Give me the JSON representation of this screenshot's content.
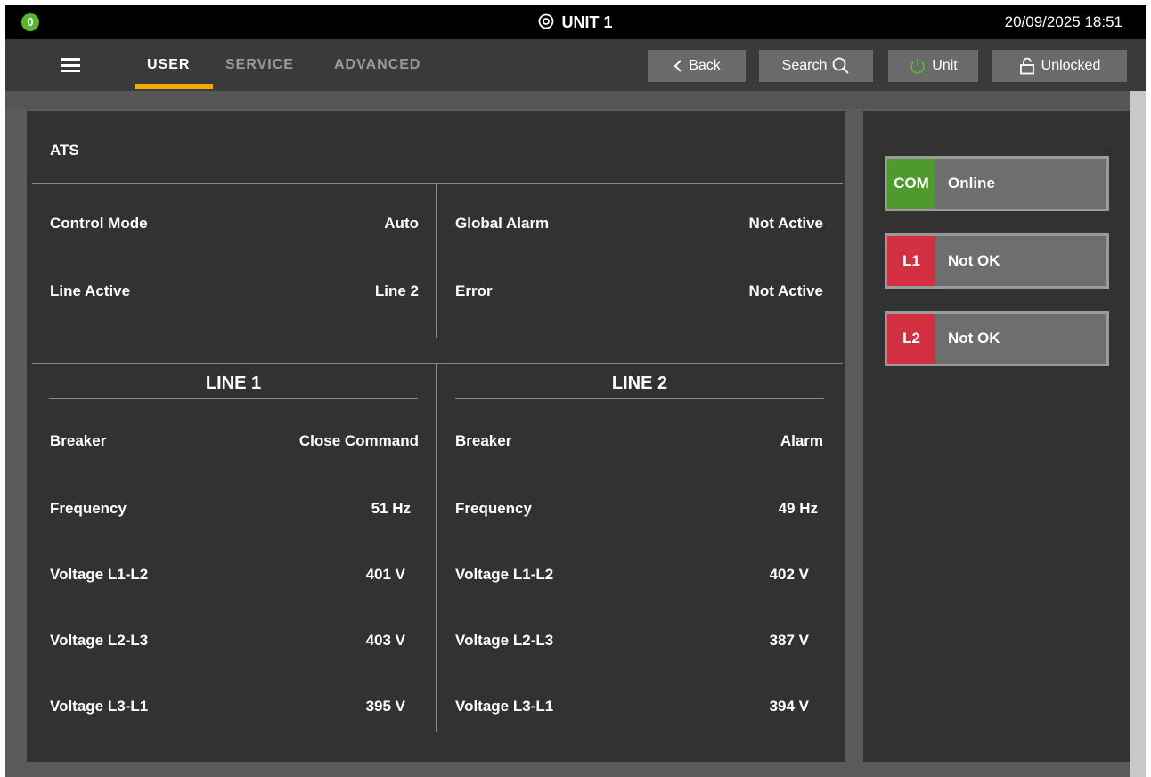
{
  "topbar": {
    "badge_count": "0",
    "unit_title": "UNIT 1",
    "datetime": "20/09/2025 18:51"
  },
  "nav": {
    "tabs": [
      {
        "label": "USER",
        "active": true
      },
      {
        "label": "SERVICE",
        "active": false
      },
      {
        "label": "ADVANCED",
        "active": false
      }
    ],
    "back_label": "Back",
    "search_label": "Search",
    "unit_label": "Unit",
    "lock_label": "Unlocked"
  },
  "ats": {
    "title": "ATS",
    "control_mode_label": "Control Mode",
    "control_mode_value": "Auto",
    "line_active_label": "Line Active",
    "line_active_value": "Line 2",
    "global_alarm_label": "Global Alarm",
    "global_alarm_value": "Not Active",
    "error_label": "Error",
    "error_value": "Not Active"
  },
  "line1": {
    "title": "LINE 1",
    "rows": [
      {
        "label": "Breaker",
        "value": "Close Command"
      },
      {
        "label": "Frequency",
        "value": "51 Hz"
      },
      {
        "label": "Voltage L1-L2",
        "value": "401 V"
      },
      {
        "label": "Voltage L2-L3",
        "value": "403 V"
      },
      {
        "label": "Voltage L3-L1",
        "value": "395 V"
      }
    ]
  },
  "line2": {
    "title": "LINE 2",
    "rows": [
      {
        "label": "Breaker",
        "value": "Alarm"
      },
      {
        "label": "Frequency",
        "value": "49 Hz"
      },
      {
        "label": "Voltage L1-L2",
        "value": "402 V"
      },
      {
        "label": "Voltage L2-L3",
        "value": "387 V"
      },
      {
        "label": "Voltage L3-L1",
        "value": "394 V"
      }
    ]
  },
  "status": [
    {
      "tag": "COM",
      "text": "Online",
      "color": "#4e9a2c"
    },
    {
      "tag": "L1",
      "text": "Not OK",
      "color": "#d23040"
    },
    {
      "tag": "L2",
      "text": "Not OK",
      "color": "#d23040"
    }
  ],
  "colors": {
    "accent": "#f2a900",
    "ok": "#4e9a2c",
    "alarm": "#d23040",
    "power_icon": "#5cb531"
  }
}
